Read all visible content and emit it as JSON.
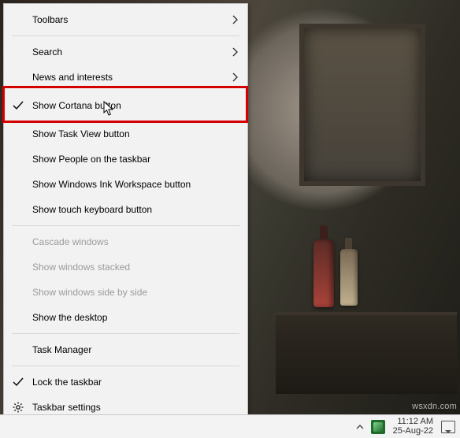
{
  "menu": {
    "toolbars": "Toolbars",
    "search": "Search",
    "news": "News and interests",
    "cortana": "Show Cortana button",
    "taskview": "Show Task View button",
    "people": "Show People on the taskbar",
    "ink": "Show Windows Ink Workspace button",
    "touchkb": "Show touch keyboard button",
    "cascade": "Cascade windows",
    "stacked": "Show windows stacked",
    "sidebyside": "Show windows side by side",
    "desktop": "Show the desktop",
    "taskmgr": "Task Manager",
    "lock": "Lock the taskbar",
    "settings": "Taskbar settings"
  },
  "tray": {
    "time": "11:12 AM",
    "date": "25-Aug-22"
  },
  "watermark": "wsxdn.com"
}
